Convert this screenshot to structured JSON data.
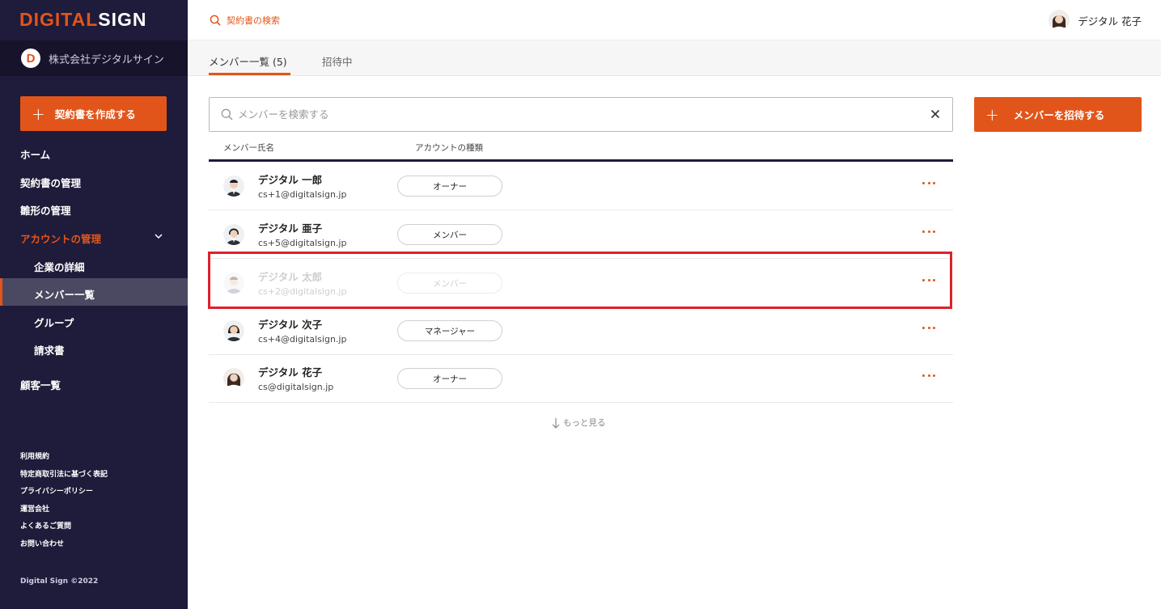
{
  "brand": {
    "logo_part1": "DIGITAL",
    "logo_part2": "SIGN",
    "accent": "#e2551a",
    "sidebar_bg": "#1f1b3a"
  },
  "company": {
    "initial": "D",
    "name": "株式会社デジタルサイン"
  },
  "sidebar": {
    "create_label": "契約書を作成する",
    "items": [
      {
        "label": "ホーム"
      },
      {
        "label": "契約書の管理"
      },
      {
        "label": "雛形の管理"
      },
      {
        "label": "アカウントの管理"
      }
    ],
    "subitems": [
      {
        "label": "企業の詳細"
      },
      {
        "label": "メンバー一覧"
      },
      {
        "label": "グループ"
      },
      {
        "label": "請求書"
      }
    ],
    "customers_label": "顧客一覧",
    "footer_links": [
      "利用規約",
      "特定商取引法に基づく表記",
      "プライバシーポリシー",
      "運営会社",
      "よくあるご質問",
      "お問い合わせ"
    ],
    "copyright": "Digital Sign ©2022"
  },
  "header": {
    "contract_search_label": "契約書の検索",
    "user_name": "デジタル 花子"
  },
  "tabs": [
    {
      "label": "メンバー一覧 (5)"
    },
    {
      "label": "招待中"
    }
  ],
  "member_search": {
    "placeholder": "メンバーを検索する"
  },
  "invite_label": "メンバーを招待する",
  "table": {
    "headers": {
      "name": "メンバー氏名",
      "account_type": "アカウントの種類"
    },
    "rows": [
      {
        "name": "デジタル 一郎",
        "email": "cs+1@digitalsign.jp",
        "role": "オーナー"
      },
      {
        "name": "デジタル 亜子",
        "email": "cs+5@digitalsign.jp",
        "role": "メンバー"
      },
      {
        "name": "デジタル 太郎",
        "email": "cs+2@digitalsign.jp",
        "role": "メンバー"
      },
      {
        "name": "デジタル 次子",
        "email": "cs+4@digitalsign.jp",
        "role": "マネージャー"
      },
      {
        "name": "デジタル 花子",
        "email": "cs@digitalsign.jp",
        "role": "オーナー"
      }
    ]
  },
  "see_more": "もっと見る"
}
